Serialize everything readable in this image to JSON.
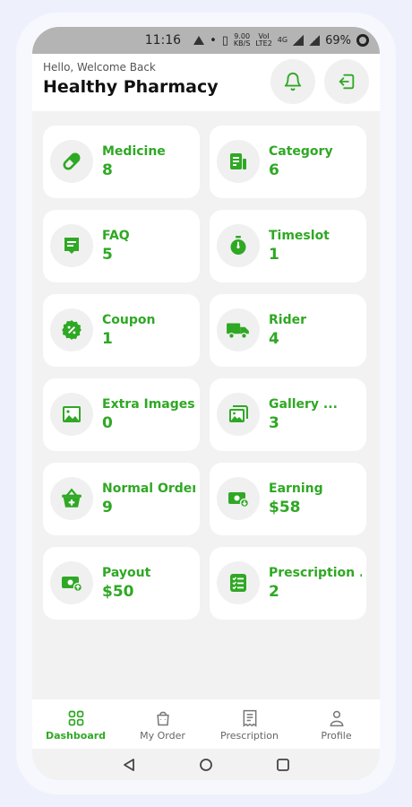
{
  "status_bar": {
    "time": "11:16",
    "net_speed_top": "9.00",
    "net_speed_bottom": "KB/S",
    "volte_top": "VoI",
    "volte_bottom": "LTE2",
    "network": "4G",
    "battery": "69%"
  },
  "header": {
    "greeting": "Hello, Welcome Back",
    "title": "Healthy Pharmacy"
  },
  "cards": [
    {
      "label": "Medicine",
      "value": "8",
      "icon": "pill-icon"
    },
    {
      "label": "Category",
      "value": "6",
      "icon": "category-icon"
    },
    {
      "label": "FAQ",
      "value": "5",
      "icon": "faq-icon"
    },
    {
      "label": "Timeslot",
      "value": "1",
      "icon": "timer-icon"
    },
    {
      "label": "Coupon",
      "value": "1",
      "icon": "coupon-icon"
    },
    {
      "label": "Rider",
      "value": "4",
      "icon": "truck-icon"
    },
    {
      "label": "Extra Images",
      "value": "0",
      "icon": "image-icon"
    },
    {
      "label": "Gallery ...",
      "value": "3",
      "icon": "gallery-icon"
    },
    {
      "label": "Normal Order",
      "value": "9",
      "icon": "basket-icon"
    },
    {
      "label": "Earning",
      "value": "$58",
      "icon": "earning-icon"
    },
    {
      "label": "Payout",
      "value": "$50",
      "icon": "payout-icon"
    },
    {
      "label": "Prescription ...",
      "value": "2",
      "icon": "prescription-list-icon"
    }
  ],
  "bottom_nav": [
    {
      "label": "Dashboard",
      "icon": "dashboard-icon",
      "active": true
    },
    {
      "label": "My Order",
      "icon": "bag-icon",
      "active": false
    },
    {
      "label": "Prescription",
      "icon": "receipt-icon",
      "active": false
    },
    {
      "label": "Profile",
      "icon": "user-icon",
      "active": false
    }
  ],
  "colors": {
    "accent": "#2fa824",
    "card_bg": "#ffffff",
    "screen_bg": "#f2f2f2",
    "icon_circle": "#f0f0f0"
  }
}
